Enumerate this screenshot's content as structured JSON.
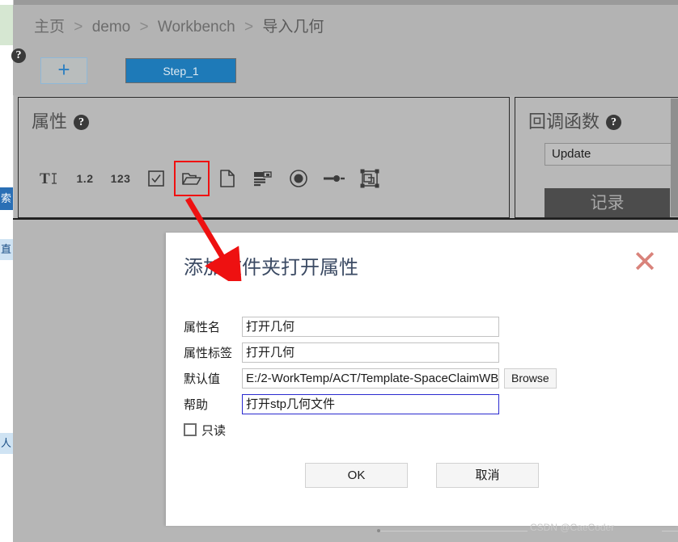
{
  "header": {
    "breadcrumb": [
      "主页",
      "demo",
      "Workbench",
      "导入几何"
    ],
    "separator": ">"
  },
  "toolbar": {
    "help_icon": "question-mark-icon",
    "add_label": "+",
    "step_label": "Step_1"
  },
  "properties_panel": {
    "title": "属性",
    "help_icon": "question-mark-icon",
    "icons": [
      {
        "name": "text-property-icon",
        "glyph": "TI",
        "kind": "svg"
      },
      {
        "name": "double-property-icon",
        "glyph": "1.2",
        "kind": "text"
      },
      {
        "name": "integer-property-icon",
        "glyph": "123",
        "kind": "text"
      },
      {
        "name": "checkbox-property-icon",
        "glyph": "checkbox",
        "kind": "svg"
      },
      {
        "name": "folder-open-property-icon",
        "glyph": "folder-open",
        "kind": "svg",
        "highlighted": true
      },
      {
        "name": "file-property-icon",
        "glyph": "file",
        "kind": "svg"
      },
      {
        "name": "list-property-icon",
        "glyph": "list",
        "kind": "svg"
      },
      {
        "name": "radio-property-icon",
        "glyph": "radio",
        "kind": "svg"
      },
      {
        "name": "expression-property-icon",
        "glyph": "node-link",
        "kind": "svg"
      },
      {
        "name": "geometry-selection-property-icon",
        "glyph": "selection-box",
        "kind": "svg"
      }
    ]
  },
  "callback_panel": {
    "title": "回调函数",
    "help_icon": "question-mark-icon",
    "input_value": "Update",
    "tab_label": "记录"
  },
  "dialog": {
    "title": "添加文件夹打开属性",
    "close_icon": "close-icon",
    "fields": [
      {
        "label": "属性名",
        "value": "打开几何",
        "name": "property-name-input",
        "focused": false,
        "browse": false
      },
      {
        "label": "属性标签",
        "value": "打开几何",
        "name": "property-label-input",
        "focused": false,
        "browse": false
      },
      {
        "label": "默认值",
        "value": "E:/2-WorkTemp/ACT/Template-SpaceClaimWB",
        "name": "default-value-input",
        "focused": false,
        "browse": true
      },
      {
        "label": "帮助",
        "value": "打开stp几何文件",
        "name": "help-text-input",
        "focused": true,
        "browse": false
      }
    ],
    "browse_label": "Browse",
    "readonly_label": "只读",
    "readonly_checked": false,
    "ok_label": "OK",
    "cancel_label": "取消"
  },
  "sidebar": {
    "items": [
      {
        "label": "索",
        "name": "sidebar-item-selected"
      },
      {
        "label": "直",
        "name": "sidebar-item-second"
      },
      {
        "label": "人",
        "name": "sidebar-item-third"
      }
    ]
  },
  "watermark": {
    "text": "CSDN @CaeCoder"
  },
  "colors": {
    "accent_blue": "#1e7ab8",
    "panel_gray": "#b8b8b8",
    "header_gray": "#b3b3b3",
    "annotation_red": "#f01010",
    "close_red": "#d9837b",
    "focus_blue": "#2a2ad0"
  }
}
